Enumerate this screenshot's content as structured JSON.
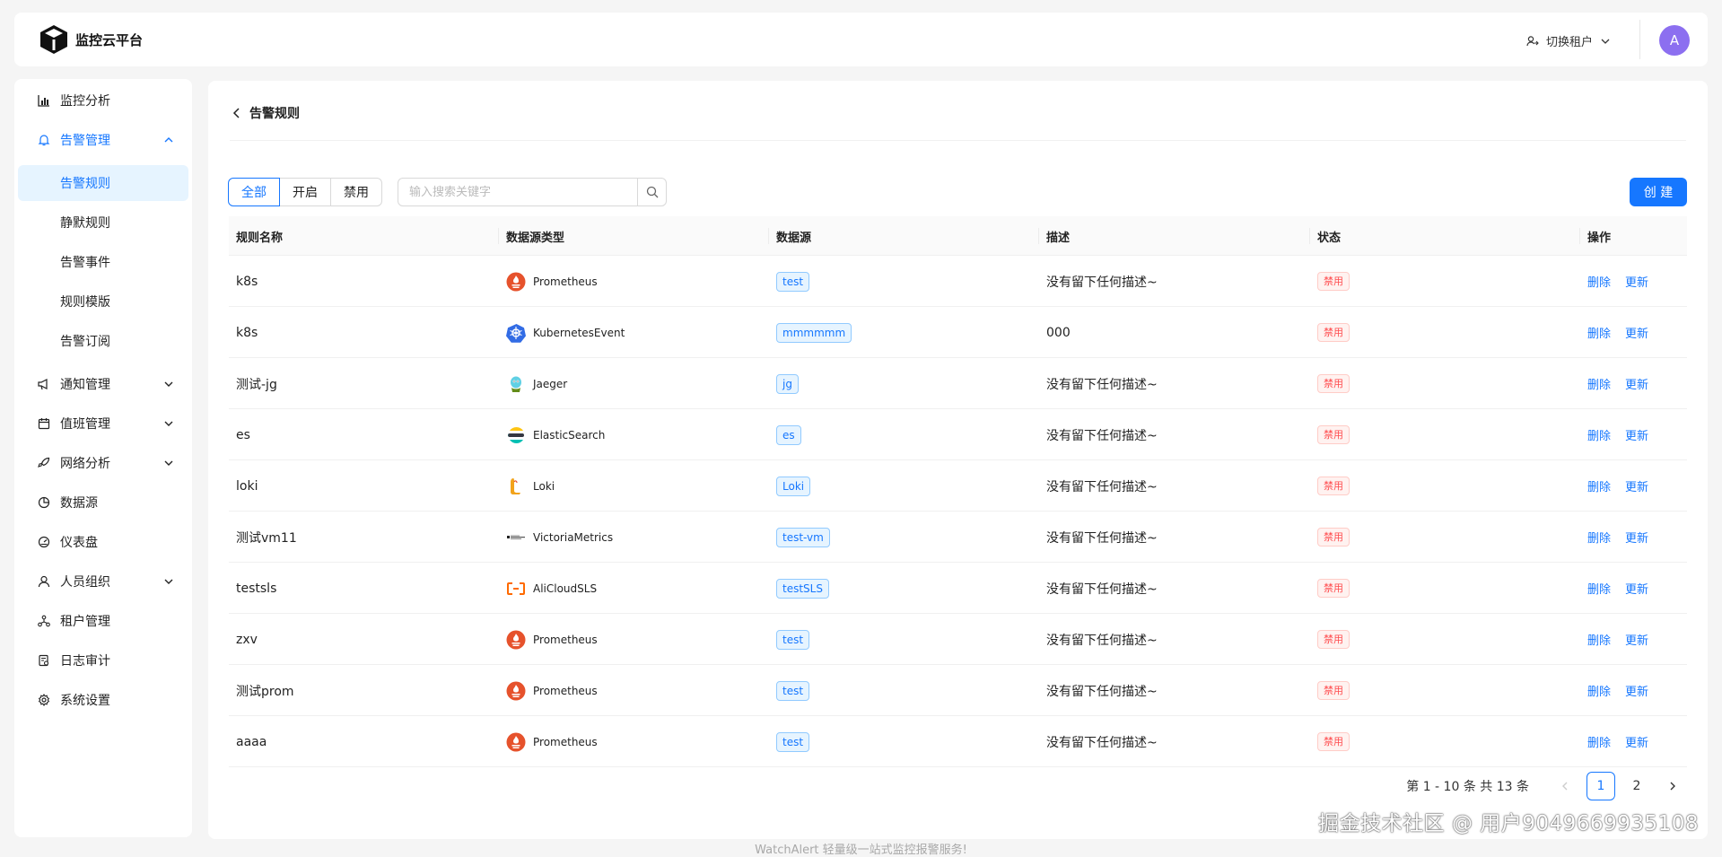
{
  "header": {
    "title": "监控云平台",
    "tenant_switch": "切换租户",
    "avatar_letter": "A"
  },
  "sidebar": {
    "items": [
      {
        "label": "监控分析",
        "icon": "bar-chart-icon"
      },
      {
        "label": "告警管理",
        "icon": "bell-icon",
        "expanded": true
      },
      {
        "label": "通知管理",
        "icon": "megaphone-icon"
      },
      {
        "label": "值班管理",
        "icon": "calendar-icon"
      },
      {
        "label": "网络分析",
        "icon": "rocket-icon"
      },
      {
        "label": "数据源",
        "icon": "pie-chart-icon"
      },
      {
        "label": "仪表盘",
        "icon": "dashboard-icon"
      },
      {
        "label": "人员组织",
        "icon": "user-icon"
      },
      {
        "label": "租户管理",
        "icon": "cluster-icon"
      },
      {
        "label": "日志审计",
        "icon": "audit-icon"
      },
      {
        "label": "系统设置",
        "icon": "settings-icon"
      }
    ],
    "alert_subitems": [
      "告警规则",
      "静默规则",
      "告警事件",
      "规则模版",
      "告警订阅"
    ],
    "active_subitem": "告警规则"
  },
  "page": {
    "title": "告警规则",
    "filters": [
      "全部",
      "开启",
      "禁用"
    ],
    "active_filter": "全部",
    "search_placeholder": "输入搜索关键字",
    "create_button": "创 建"
  },
  "table": {
    "columns": [
      "规则名称",
      "数据源类型",
      "数据源",
      "描述",
      "状态",
      "操作"
    ],
    "rows": [
      {
        "name": "k8s",
        "ds_type": "Prometheus",
        "ds_icon": "prometheus-icon",
        "datasource": "test",
        "desc": "没有留下任何描述~",
        "status": "禁用"
      },
      {
        "name": "k8s",
        "ds_type": "KubernetesEvent",
        "ds_icon": "kubernetes-icon",
        "datasource": "mmmmmm",
        "desc": "000",
        "status": "禁用"
      },
      {
        "name": "测试-jg",
        "ds_type": "Jaeger",
        "ds_icon": "jaeger-icon",
        "datasource": "jg",
        "desc": "没有留下任何描述~",
        "status": "禁用"
      },
      {
        "name": "es",
        "ds_type": "ElasticSearch",
        "ds_icon": "elasticsearch-icon",
        "datasource": "es",
        "desc": "没有留下任何描述~",
        "status": "禁用"
      },
      {
        "name": "loki",
        "ds_type": "Loki",
        "ds_icon": "loki-icon",
        "datasource": "Loki",
        "desc": "没有留下任何描述~",
        "status": "禁用"
      },
      {
        "name": "测试vm11",
        "ds_type": "VictoriaMetrics",
        "ds_icon": "victoriametrics-icon",
        "datasource": "test-vm",
        "desc": "没有留下任何描述~",
        "status": "禁用"
      },
      {
        "name": "testsls",
        "ds_type": "AliCloudSLS",
        "ds_icon": "alicloud-icon",
        "datasource": "testSLS",
        "desc": "没有留下任何描述~",
        "status": "禁用"
      },
      {
        "name": "zxv",
        "ds_type": "Prometheus",
        "ds_icon": "prometheus-icon",
        "datasource": "test",
        "desc": "没有留下任何描述~",
        "status": "禁用"
      },
      {
        "name": "测试prom",
        "ds_type": "Prometheus",
        "ds_icon": "prometheus-icon",
        "datasource": "test",
        "desc": "没有留下任何描述~",
        "status": "禁用"
      },
      {
        "name": "aaaa",
        "ds_type": "Prometheus",
        "ds_icon": "prometheus-icon",
        "datasource": "test",
        "desc": "没有留下任何描述~",
        "status": "禁用"
      }
    ],
    "actions": {
      "delete": "删除",
      "update": "更新"
    }
  },
  "pagination": {
    "summary": "第 1 - 10 条 共 13 条",
    "pages": [
      "1",
      "2"
    ],
    "current": "1"
  },
  "footer": "WatchAlert 轻量级一站式监控报警服务!",
  "watermark": "掘金技术社区 @ 用户9049669935108",
  "colors": {
    "accent": "#1677ff",
    "danger": "#ff4d4f",
    "avatar": "#8c6ff0"
  }
}
